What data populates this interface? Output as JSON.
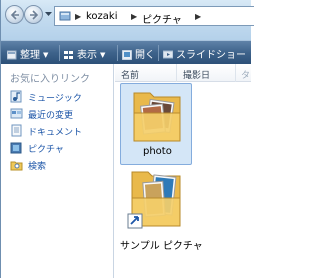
{
  "address": {
    "crumbs": [
      "kozaki",
      "ピクチャ"
    ]
  },
  "toolbar": {
    "organize_label": "整理",
    "views_label": "表示",
    "open_label": "開く",
    "slideshow_label": "スライドショー"
  },
  "navpane": {
    "title": "お気に入りリンク",
    "items": [
      {
        "label": "ミュージック",
        "icon": "music-icon"
      },
      {
        "label": "最近の変更",
        "icon": "recent-changes-icon"
      },
      {
        "label": "ドキュメント",
        "icon": "documents-icon"
      },
      {
        "label": "ピクチャ",
        "icon": "pictures-icon"
      },
      {
        "label": "検索",
        "icon": "search-folder-icon"
      }
    ]
  },
  "columns": [
    "名前",
    "撮影日"
  ],
  "files": [
    {
      "name": "photo",
      "icon": "folder-icon",
      "selected": true
    },
    {
      "name": "サンプル ピクチャ",
      "icon": "folder-shortcut-icon",
      "selected": false
    }
  ],
  "colors": {
    "link": "#1d56a8",
    "selection": "#d4e6f7",
    "commandbar": "#3e638b"
  }
}
